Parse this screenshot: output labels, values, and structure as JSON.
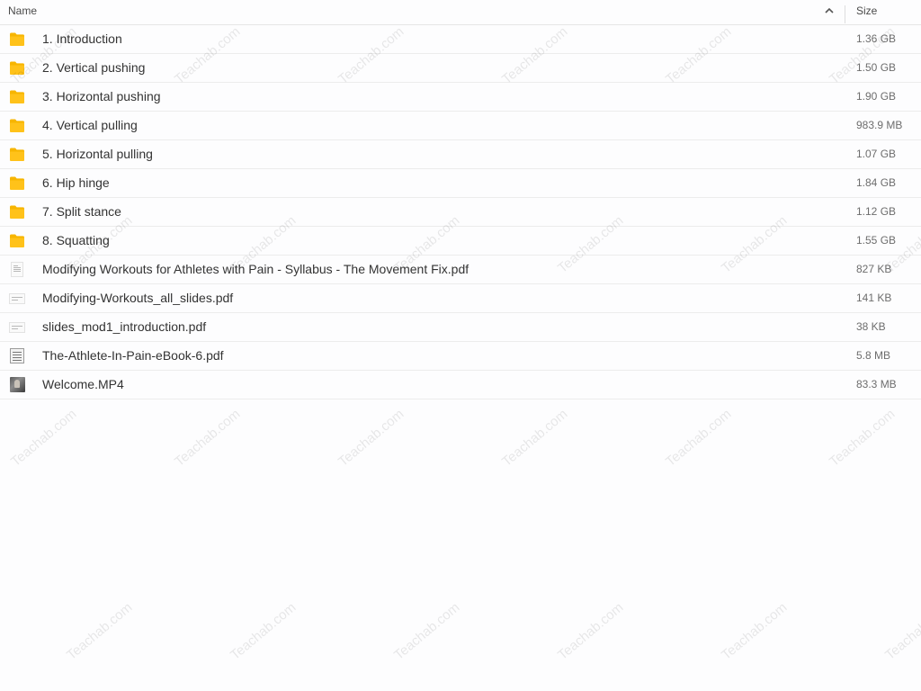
{
  "header": {
    "name_label": "Name",
    "size_label": "Size",
    "sort_icon": "chevron-up-icon"
  },
  "files": [
    {
      "name": "1. Introduction",
      "size": "1.36 GB",
      "type": "folder"
    },
    {
      "name": "2. Vertical pushing",
      "size": "1.50 GB",
      "type": "folder"
    },
    {
      "name": "3. Horizontal pushing",
      "size": "1.90 GB",
      "type": "folder"
    },
    {
      "name": "4. Vertical pulling",
      "size": "983.9 MB",
      "type": "folder"
    },
    {
      "name": "5. Horizontal pulling",
      "size": "1.07 GB",
      "type": "folder"
    },
    {
      "name": "6. Hip hinge",
      "size": "1.84 GB",
      "type": "folder"
    },
    {
      "name": "7. Split stance",
      "size": "1.12 GB",
      "type": "folder"
    },
    {
      "name": "8. Squatting",
      "size": "1.55 GB",
      "type": "folder"
    },
    {
      "name": "Modifying Workouts for Athletes with Pain - Syllabus - The Movement Fix.pdf",
      "size": "827 KB",
      "type": "pdf-doc"
    },
    {
      "name": "Modifying-Workouts_all_slides.pdf",
      "size": "141 KB",
      "type": "pdf-slides"
    },
    {
      "name": "slides_mod1_introduction.pdf",
      "size": "38 KB",
      "type": "pdf-slides"
    },
    {
      "name": "The-Athlete-In-Pain-eBook-6.pdf",
      "size": "5.8 MB",
      "type": "pdf-book"
    },
    {
      "name": "Welcome.MP4",
      "size": "83.3 MB",
      "type": "video"
    }
  ],
  "watermark": "Teachab.com",
  "colors": {
    "folder": "#f7b500",
    "background": "#fdfdfe",
    "divider": "#ececec"
  }
}
